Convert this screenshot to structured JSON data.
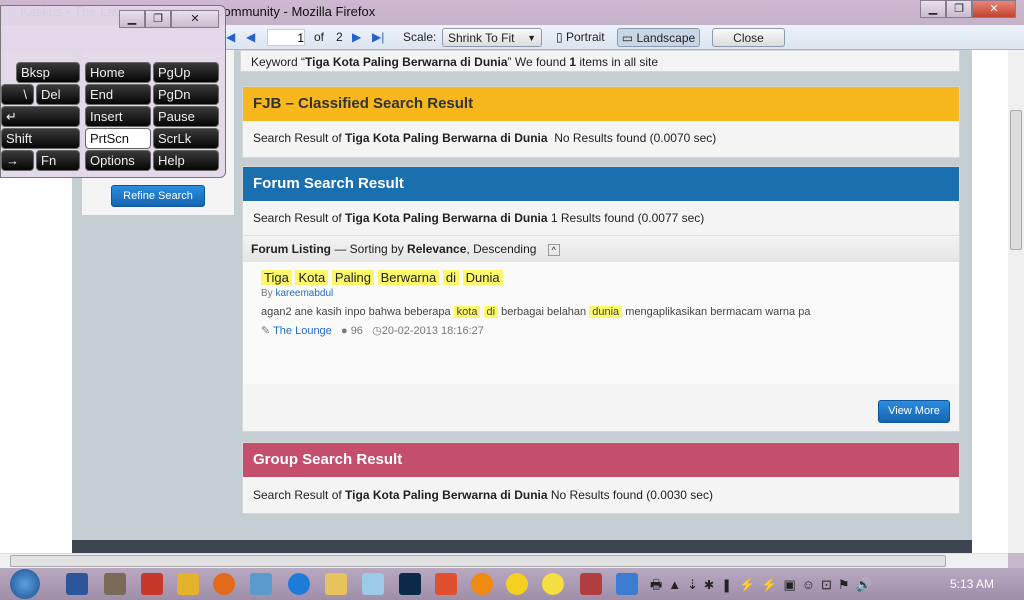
{
  "window": {
    "title": "Kaskus - The Largest Indonesian Community - Mozilla Firefox",
    "minimize": "▁",
    "restore": "❐",
    "close": "✕"
  },
  "print_preview": {
    "page": "1",
    "of": "of",
    "total": "2",
    "scale_label": "Scale:",
    "scale_value": "Shrink To Fit",
    "portrait": "Portrait",
    "landscape": "Landscape",
    "close": "Close"
  },
  "osk": {
    "keys": [
      [
        "Bksp",
        "Home",
        "PgUp"
      ],
      [
        "\\",
        "Del",
        "End",
        "PgDn"
      ],
      [
        "↵",
        "Insert",
        "Pause"
      ],
      [
        "Shift",
        "PrtScn",
        "ScrLk"
      ],
      [
        "→",
        "Fn",
        "Options",
        "Help"
      ]
    ]
  },
  "sidebar": {
    "refine": "Refine Search"
  },
  "keyword": {
    "prefix": "Keyword “",
    "term": "Tiga Kota Paling Berwarna di Dunia",
    "middle": "” We found ",
    "count": "1",
    "suffix": " items in all site"
  },
  "fjb": {
    "title": "FJB – Classified Search Result",
    "prefix": "Search Result of ",
    "term": "Tiga Kota Paling Berwarna di Dunia",
    "result": "No Results found (0.0070 sec)",
    "color": "#f6b81c"
  },
  "forum": {
    "title": "Forum Search Result",
    "prefix": "Search Result of ",
    "term": "Tiga Kota Paling Berwarna di Dunia",
    "result": "1 Results found (0.0077 sec)",
    "color": "#1a6fae",
    "listing": {
      "label": "Forum Listing",
      "sep": " — Sorting by ",
      "sort": "Relevance",
      "order": ", Descending"
    },
    "item": {
      "title_words": [
        "Tiga",
        "Kota",
        "Paling",
        "Berwarna",
        "di",
        "Dunia"
      ],
      "by": "By ",
      "author": "kareemabdul",
      "snippet": [
        "agan2 ane kasih inpo bahwa beberapa ",
        "kota",
        "di",
        "berbagai belahan ",
        "dunia",
        " mengaplikasikan bermacam warna pa"
      ],
      "category": "The Lounge",
      "comments": "96",
      "date": "20-02-2013 18:16:27"
    },
    "view_more": "View More"
  },
  "group": {
    "title": "Group Search Result",
    "prefix": "Search Result of ",
    "term": "Tiga Kota Paling Berwarna di Dunia",
    "result": "No Results found (0.0030 sec)",
    "color": "#c44f6c"
  },
  "taskbar": {
    "time": "5:13 AM"
  }
}
